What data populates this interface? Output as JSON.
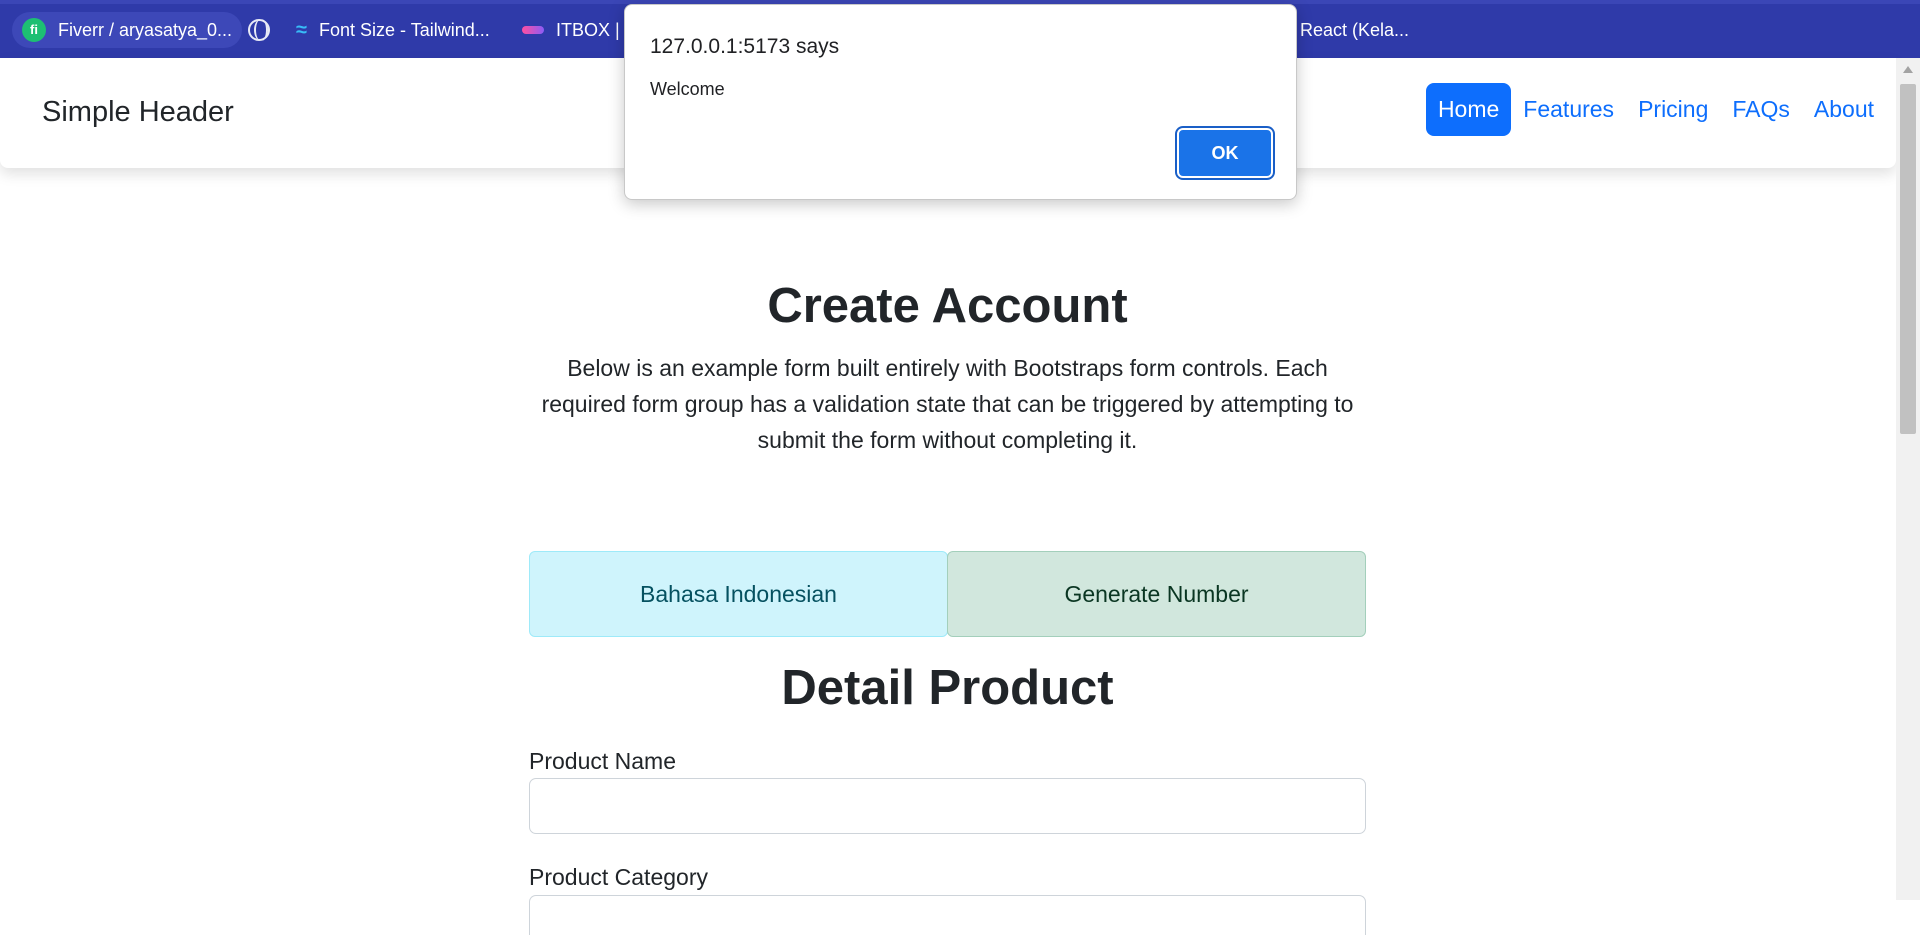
{
  "bookmarks": [
    {
      "label": "Fiverr / aryasatya_0...",
      "icon": "fiverr-icon"
    },
    {
      "label": "",
      "icon": "globe-icon"
    },
    {
      "label": "Font Size - Tailwind...",
      "icon": "tailwind-icon"
    },
    {
      "label": "ITBOX | F",
      "icon": "itbox-icon"
    },
    {
      "label": "React (Kela...",
      "icon": ""
    }
  ],
  "navbar": {
    "brand": "Simple Header",
    "links": [
      "Home",
      "Features",
      "Pricing",
      "FAQs",
      "About"
    ],
    "active": "Home"
  },
  "main": {
    "title": "Create Account",
    "description": "Below is an example form built entirely with Bootstraps form controls. Each required form group has a validation state that can be triggered by attempting to submit the form without completing it.",
    "buttons": {
      "language": "Bahasa Indonesian",
      "generate": "Generate Number"
    },
    "subtitle": "Detail Product",
    "fields": {
      "product_name_label": "Product Name",
      "product_name_value": "",
      "product_category_label": "Product Category"
    }
  },
  "dialog": {
    "title": "127.0.0.1:5173 says",
    "message": "Welcome",
    "ok_label": "OK"
  },
  "colors": {
    "bookmarks_bar": "#2f3aa9",
    "primary": "#0d6efd",
    "info_bg": "#cff4fc",
    "success_bg": "#d1e7dd",
    "dialog_ok": "#1a73e8"
  }
}
